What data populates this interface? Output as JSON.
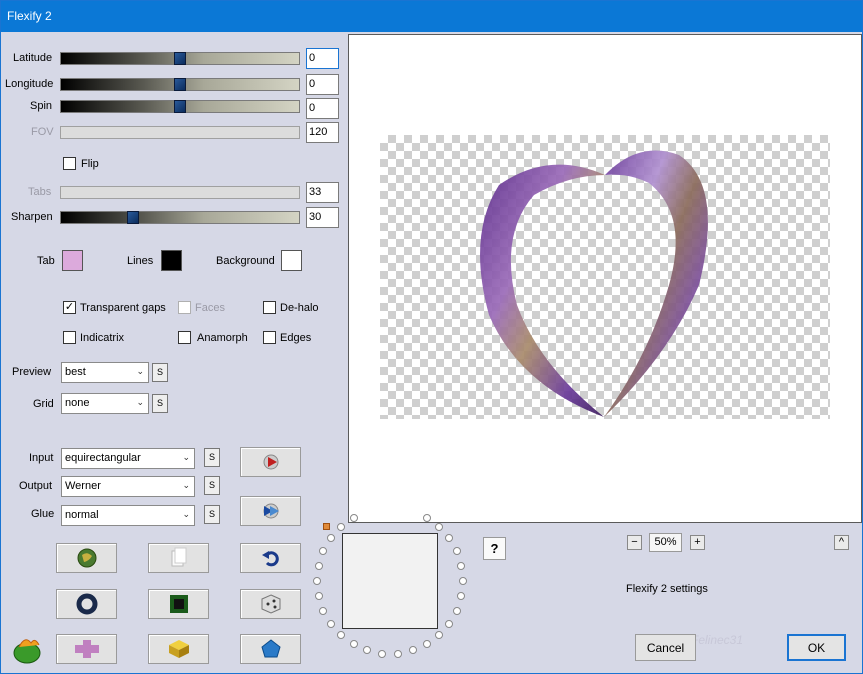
{
  "window": {
    "title": "Flexify 2"
  },
  "sliders": [
    {
      "label": "Latitude",
      "value": "0",
      "enabled": true,
      "position": 0.5
    },
    {
      "label": "Longitude",
      "value": "0",
      "enabled": true,
      "position": 0.5
    },
    {
      "label": "Spin",
      "value": "0",
      "enabled": true,
      "position": 0.5
    },
    {
      "label": "FOV",
      "value": "120",
      "enabled": false
    },
    {
      "label": "Tabs",
      "value": "33",
      "enabled": false
    },
    {
      "label": "Sharpen",
      "value": "30",
      "enabled": true,
      "position": 0.3
    }
  ],
  "flip": {
    "label": "Flip",
    "checked": false
  },
  "colors": {
    "tab": {
      "label": "Tab",
      "color": "#dcaadc"
    },
    "lines": {
      "label": "Lines",
      "color": "#000000"
    },
    "background": {
      "label": "Background",
      "color": "#ffffff"
    }
  },
  "options": {
    "transparent_gaps": {
      "label": "Transparent gaps",
      "checked": true
    },
    "faces": {
      "label": "Faces",
      "checked": false,
      "enabled": false
    },
    "de_halo": {
      "label": "De-halo",
      "checked": false
    },
    "indicatrix": {
      "label": "Indicatrix",
      "checked": false
    },
    "anamorph": {
      "label": "Anamorph",
      "checked": false
    },
    "edges": {
      "label": "Edges",
      "checked": false
    }
  },
  "preview_select": {
    "label": "Preview",
    "value": "best"
  },
  "grid_select": {
    "label": "Grid",
    "value": "none"
  },
  "input_select": {
    "label": "Input",
    "value": "equirectangular"
  },
  "output_select": {
    "label": "Output",
    "value": "Werner"
  },
  "glue_select": {
    "label": "Glue",
    "value": "normal"
  },
  "small_button_label": "S",
  "help_label": "?",
  "zoom": {
    "value": "50%",
    "minus": "−",
    "plus": "+"
  },
  "collapse_label": "^",
  "settings_label": "Flexify 2 settings",
  "watermark": "Felinec31",
  "buttons": {
    "cancel": "Cancel",
    "ok": "OK"
  },
  "accent_color": "#0b78d6"
}
